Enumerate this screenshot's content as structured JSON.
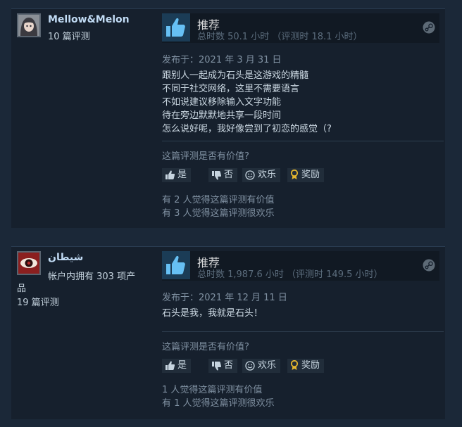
{
  "colors": {
    "background": "#1b2838",
    "card": "#16202d",
    "accent": "#66c0f4",
    "thumb_bg": "#1b3c56"
  },
  "reviews": [
    {
      "author": {
        "name": "Mellow&Melon",
        "review_count": "10 篇评测"
      },
      "recommendation": {
        "title": "推荐",
        "hours": "总时数 50.1 小时 （评测时 18.1 小时）",
        "icon": "thumbs-up-icon"
      },
      "posted": "发布于：2021 年 3 月 31 日",
      "lines": [
        "跟别人一起成为石头是这游戏的精髓",
        "不同于社交网络，这里不需要语言",
        "不如说建议移除输入文字功能",
        "待在旁边默默地共享一段时间",
        "怎么说好呢，我好像尝到了初恋的感觉（?"
      ],
      "helpful_question": "这篇评测是否有价值?",
      "buttons": {
        "yes": "是",
        "no": "否",
        "funny": "欢乐",
        "award": "奖励"
      },
      "stats": [
        "有 2 人觉得这篇评测有价值",
        "有 3 人觉得这篇评测很欢乐"
      ]
    },
    {
      "author": {
        "name": "شيطان",
        "products_line1": "帐户内拥有 303 项产",
        "products_line2": "品",
        "review_count": "19 篇评测"
      },
      "recommendation": {
        "title": "推荐",
        "hours": "总时数 1,987.6 小时 （评测时 149.5 小时）",
        "icon": "thumbs-up-icon"
      },
      "posted": "发布于：2021 年 12 月 11 日",
      "lines": [
        "石头是我，我就是石头！"
      ],
      "helpful_question": "这篇评测是否有价值?",
      "buttons": {
        "yes": "是",
        "no": "否",
        "funny": "欢乐",
        "award": "奖励"
      },
      "stats": [
        "1 人觉得这篇评测有价值",
        "有 1 人觉得这篇评测很欢乐"
      ]
    }
  ]
}
